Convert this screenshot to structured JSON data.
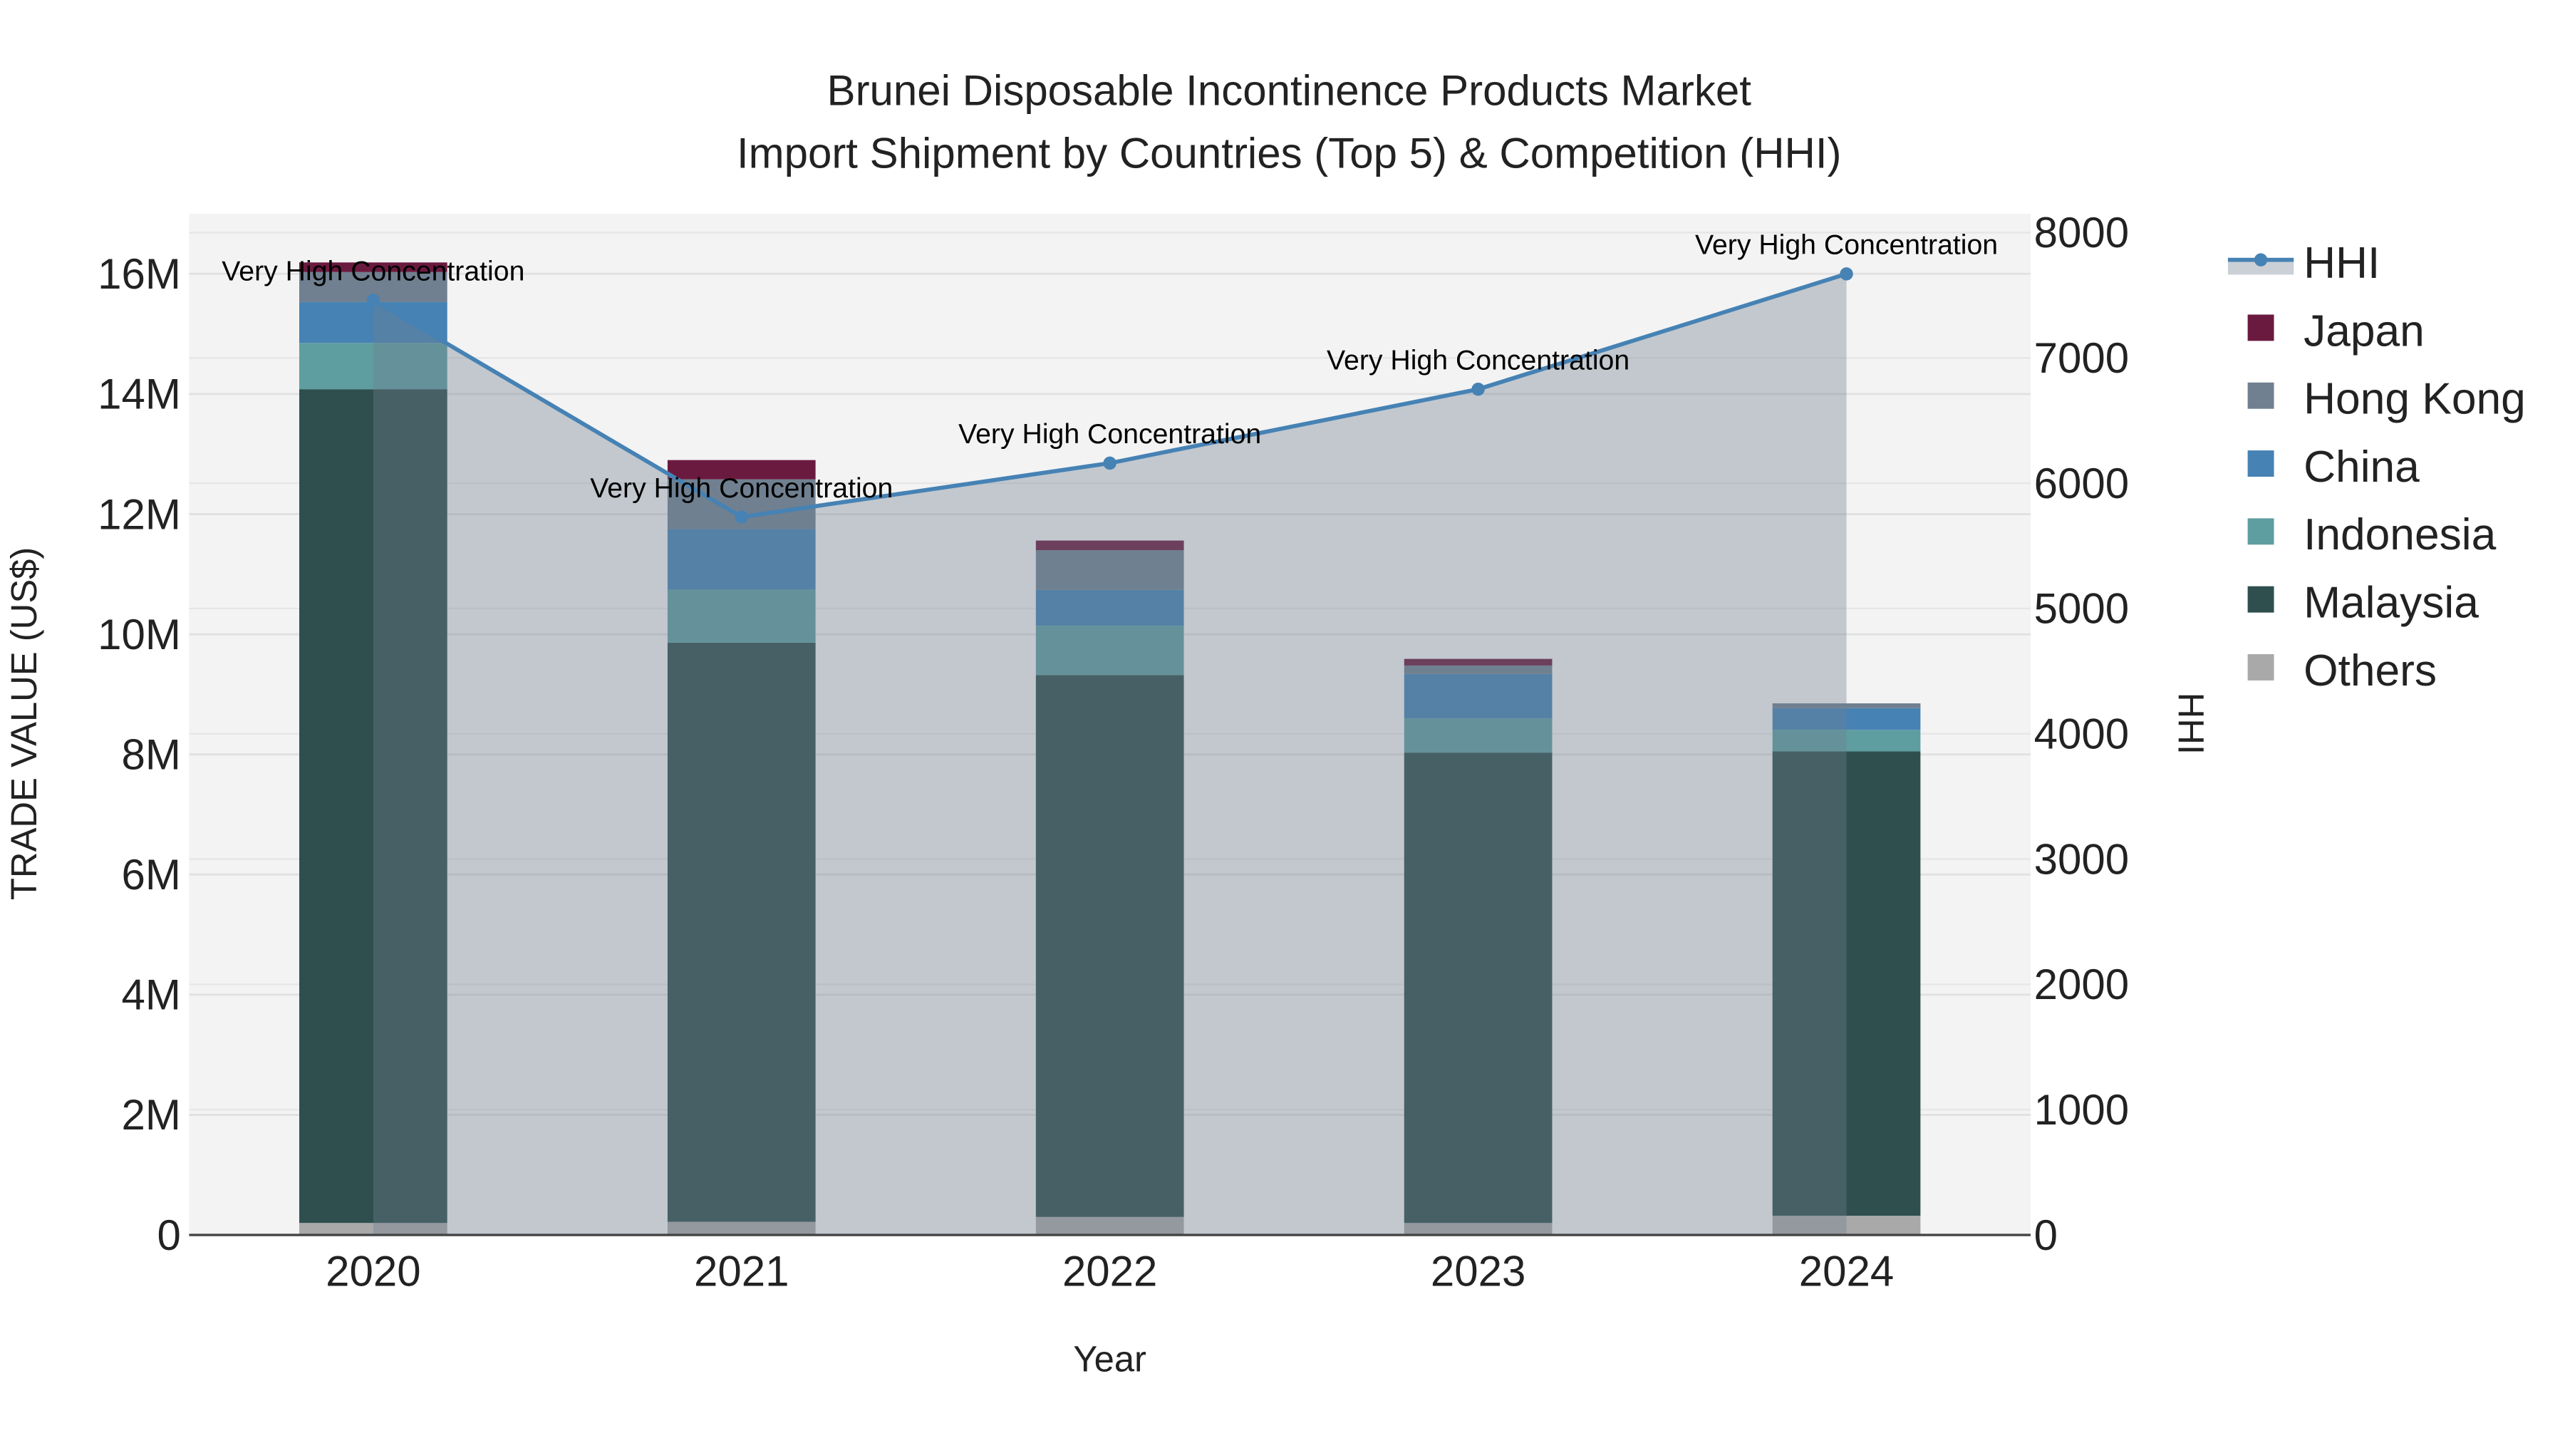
{
  "chart_data": {
    "type": "bar",
    "title_line1": "Brunei Disposable Incontinence Products Market",
    "title_line2": "Import Shipment by Countries (Top 5) & Competition (HHI)",
    "xlabel": "Year",
    "ylabel": "TRADE VALUE (US$)",
    "y2label": "HHI",
    "categories": [
      "2020",
      "2021",
      "2022",
      "2023",
      "2024"
    ],
    "ylim": [
      0,
      17000000
    ],
    "y_ticks": [
      0,
      2000000,
      4000000,
      6000000,
      8000000,
      10000000,
      12000000,
      14000000,
      16000000
    ],
    "y_tick_labels": [
      "0",
      "2M",
      "4M",
      "6M",
      "8M",
      "10M",
      "12M",
      "14M",
      "16M"
    ],
    "y2lim": [
      0,
      8150
    ],
    "y2_ticks": [
      0,
      1000,
      2000,
      3000,
      4000,
      5000,
      6000,
      7000,
      8000
    ],
    "y2_tick_labels": [
      "0",
      "1000",
      "2000",
      "3000",
      "4000",
      "5000",
      "6000",
      "7000",
      "8000"
    ],
    "grid": true,
    "legend_placement": "right",
    "series": [
      {
        "name": "Others",
        "color": "#a9a9a9",
        "values": [
          200000,
          220000,
          300000,
          200000,
          320000
        ]
      },
      {
        "name": "Malaysia",
        "color": "#2f4f4f",
        "values": [
          13880000,
          9640000,
          9020000,
          7830000,
          7730000
        ]
      },
      {
        "name": "Indonesia",
        "color": "#5f9ea0",
        "values": [
          770000,
          880000,
          820000,
          570000,
          360000
        ]
      },
      {
        "name": "China",
        "color": "#4682b4",
        "values": [
          680000,
          1010000,
          600000,
          740000,
          360000
        ]
      },
      {
        "name": "Hong Kong",
        "color": "#708090",
        "values": [
          500000,
          830000,
          660000,
          140000,
          80000
        ]
      },
      {
        "name": "Japan",
        "color": "#6b1a3f",
        "values": [
          160000,
          320000,
          160000,
          110000,
          0
        ]
      }
    ],
    "hhi": {
      "name": "HHI",
      "color": "#4682b4",
      "values": [
        7460,
        5730,
        6160,
        6750,
        7670
      ],
      "annotations": [
        "Very High Concentration",
        "Very High Concentration",
        "Very High Concentration",
        "Very High Concentration",
        "Very High Concentration"
      ]
    },
    "legend_order": [
      "HHI",
      "Japan",
      "Hong Kong",
      "China",
      "Indonesia",
      "Malaysia",
      "Others"
    ]
  }
}
